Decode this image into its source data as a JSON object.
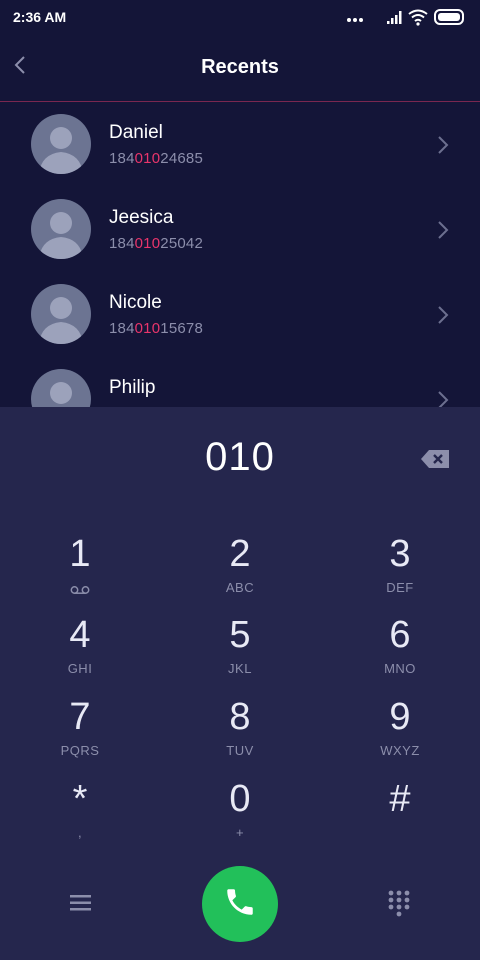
{
  "status": {
    "time": "2:36 AM"
  },
  "header": {
    "title": "Recents"
  },
  "contacts": [
    {
      "name": "Daniel",
      "number_prefix": "184",
      "number_match": "010",
      "number_suffix": "24685"
    },
    {
      "name": "Jeesica",
      "number_prefix": "184",
      "number_match": "010",
      "number_suffix": "25042"
    },
    {
      "name": "Nicole",
      "number_prefix": "184",
      "number_match": "010",
      "number_suffix": "15678"
    },
    {
      "name": "Philip",
      "number_prefix": "",
      "number_match": "",
      "number_suffix": ""
    }
  ],
  "dialpad": {
    "entered": "010",
    "keys": [
      {
        "digit": "1",
        "letters": ""
      },
      {
        "digit": "2",
        "letters": "ABC"
      },
      {
        "digit": "3",
        "letters": "DEF"
      },
      {
        "digit": "4",
        "letters": "GHI"
      },
      {
        "digit": "5",
        "letters": "JKL"
      },
      {
        "digit": "6",
        "letters": "MNO"
      },
      {
        "digit": "7",
        "letters": "PQRS"
      },
      {
        "digit": "8",
        "letters": "TUV"
      },
      {
        "digit": "9",
        "letters": "WXYZ"
      },
      {
        "digit": "*",
        "letters": ","
      },
      {
        "digit": "0",
        "letters": "+"
      },
      {
        "digit": "#",
        "letters": ""
      }
    ]
  },
  "icons": {
    "back": "chevron-left-icon",
    "delete": "backspace-icon",
    "menu": "menu-icon",
    "call": "phone-icon",
    "keypad": "dialpad-icon",
    "voicemail": "voicemail-icon"
  },
  "colors": {
    "background": "#141538",
    "dialpad_background": "#25264d",
    "highlight": "#e8356b",
    "call_button": "#22c05a",
    "divider": "#7a2750"
  }
}
